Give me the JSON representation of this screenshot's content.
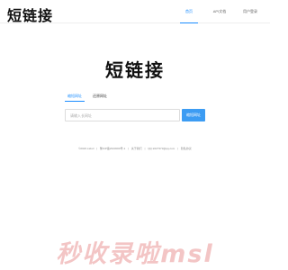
{
  "header": {
    "logo": "短链接",
    "nav": [
      {
        "label": "首页",
        "active": true
      },
      {
        "label": "API文档",
        "active": false
      },
      {
        "label": "用户登录",
        "active": false
      }
    ]
  },
  "hero": {
    "title": "短链接"
  },
  "mode_tabs": [
    {
      "label": "缩短网址",
      "active": true
    },
    {
      "label": "还原网址",
      "active": false
    }
  ],
  "form": {
    "input_placeholder": "请输入长网址",
    "submit_label": "缩短网址"
  },
  "footer": {
    "items": [
      "©2023 Ltdurl",
      "豫ICP备2023000号-1",
      "关于我们",
      "QQ:2227373@qq.com",
      "隐私协议"
    ],
    "separator": "|"
  },
  "watermark": "秒收录啦msl",
  "colors": {
    "accent": "#1a8cff",
    "button": "#3c9cf3",
    "watermark": "#f1bcbc"
  }
}
